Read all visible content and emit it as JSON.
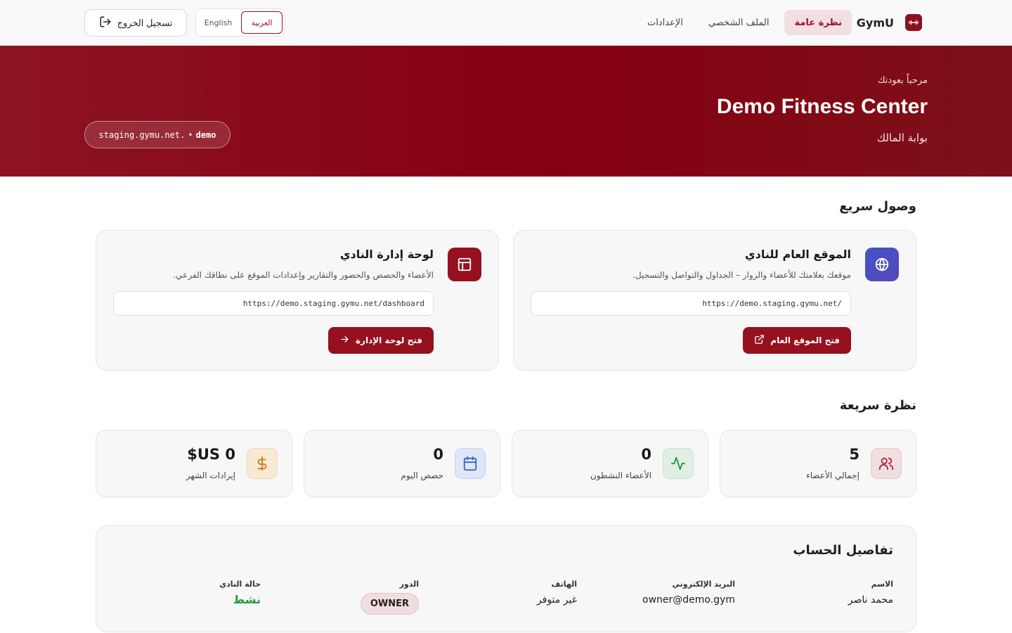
{
  "nav": {
    "brand": "GymU",
    "links": [
      {
        "label": "نظرة عامة",
        "active": true
      },
      {
        "label": "الملف الشخصي",
        "active": false
      },
      {
        "label": "الإعدادات",
        "active": false
      }
    ],
    "lang": {
      "arabic": "العربية",
      "english": "English",
      "active": "arabic"
    },
    "logout_label": "تسجيل الخروج"
  },
  "hero": {
    "welcome": "مرحباً بعودتك",
    "club_name": "Demo Fitness Center",
    "portal": "بوابة المالك",
    "domain_prefix": "demo",
    "domain_dot": "•",
    "domain_suffix": "staging.gymu.net."
  },
  "quick_access": {
    "title": "وصول سريع",
    "cards": [
      {
        "key": "public-site",
        "icon": "globe-icon",
        "title": "الموقع العام للنادي",
        "description": "موقعك بعلامتك للأعضاء والزوار – الجداول والتواصل والتسجيل.",
        "url": "https://demo.staging.gymu.net/",
        "button": "فتح الموقع العام"
      },
      {
        "key": "dashboard",
        "icon": "layout-icon",
        "title": "لوحة إدارة النادي",
        "description": "الأعضاء والحصص والحضور والتقارير وإعدادات الموقع على نطاقك الفرعي.",
        "url": "https://demo.staging.gymu.net/dashboard",
        "button": "فتح لوحة الإدارة"
      }
    ]
  },
  "overview": {
    "title": "نظرة سريعة",
    "stats": [
      {
        "label": "إجمالي الأعضاء",
        "value": "5",
        "icon": "users-icon"
      },
      {
        "label": "الأعضاء النشطون",
        "value": "0",
        "icon": "activity-icon"
      },
      {
        "label": "حصص اليوم",
        "value": "0",
        "icon": "calendar-icon"
      },
      {
        "label": "إيرادات الشهر",
        "value": "0 US$",
        "icon": "dollar-icon"
      }
    ]
  },
  "account": {
    "title": "تفاصيل الحساب",
    "name_label": "الاسم",
    "name": "محمد ناصر",
    "email_label": "البريد الإلكتروني",
    "email": "owner@demo.gym",
    "phone_label": "الهاتف",
    "phone": "غير متوفر",
    "role_label": "الدور",
    "role": "OWNER",
    "status_label": "حالة النادي",
    "status": "نشط"
  },
  "colors": {
    "brand": "#96101f",
    "hero": "#860012",
    "active_status": "#1f9d3a"
  }
}
